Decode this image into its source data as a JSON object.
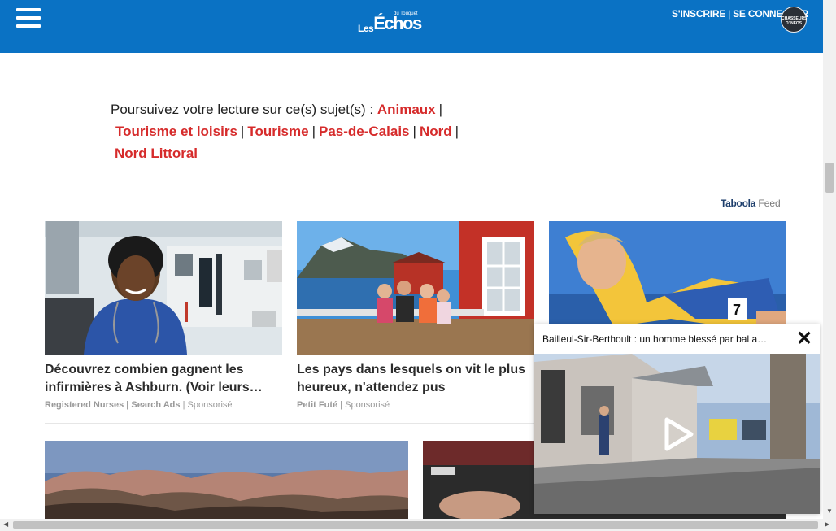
{
  "header": {
    "logo_les": "Les",
    "logo_echos": "Échos",
    "logo_du": "du Touquet",
    "signup": "S'INSCRIRE",
    "separator": "|",
    "login": "SE CONNECTER",
    "badge": "CHASSEURS D'INFOS"
  },
  "topics": {
    "intro": "Poursuivez votre lecture sur ce(s) sujet(s) :",
    "items": [
      "Animaux",
      "Tourisme et loisirs",
      "Tourisme",
      "Pas-de-Calais",
      "Nord",
      "Nord Littoral"
    ],
    "separator": "|"
  },
  "taboola": {
    "brand": "Taboola",
    "label": "Feed"
  },
  "cards": [
    {
      "title": "Découvrez combien gagnent les infirmières à Ashburn. (Voir leurs…",
      "source": "Registered Nurses | Search Ads",
      "sponsored": "Sponsorisé"
    },
    {
      "title": "Les pays dans lesquels on vit le plus heureux, n'attendez pus",
      "source": "Petit Futé",
      "sponsored": "Sponsorisé"
    },
    {
      "title": "",
      "source": "",
      "sponsored": ""
    }
  ],
  "video": {
    "title": "Bailleul-Sir-Berthoult : un homme blessé par bal a…",
    "close": "✕"
  },
  "colors": {
    "header_bg": "#0a72c4",
    "topic_link": "#d62b2b"
  }
}
